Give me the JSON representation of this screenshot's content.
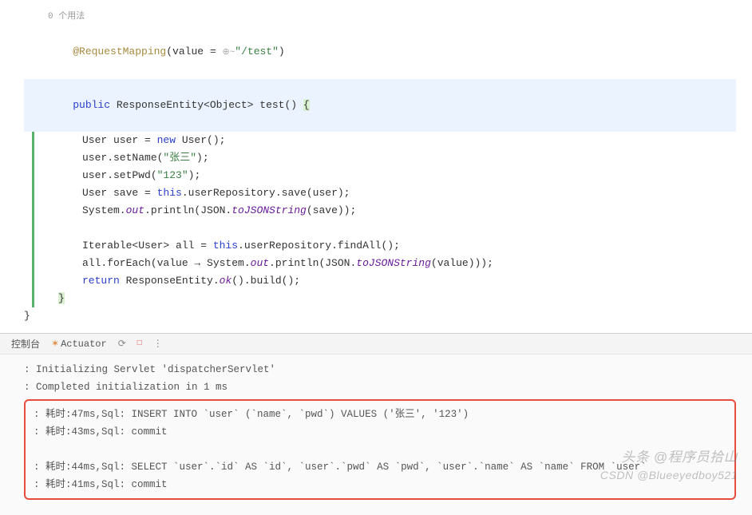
{
  "editor": {
    "usage_hint": "0 个用法",
    "annotation": "@RequestMapping",
    "ann_args_prefix": "(value = ",
    "ann_globe": "⊕~",
    "ann_url": "\"/test\"",
    "ann_args_suffix": ")",
    "line_public": "public",
    "sig_rest": " ResponseEntity<Object> test() ",
    "brace_open": "{",
    "l1a": "User user = ",
    "l1_new": "new",
    "l1b": " User();",
    "l2a": "user.setName(",
    "l2s": "\"张三\"",
    "l2b": ");",
    "l3a": "user.setPwd(",
    "l3s": "\"123\"",
    "l3b": ");",
    "l4a": "User save = ",
    "l4_this": "this",
    "l4b": ".userRepository.save(user);",
    "l5a": "System.",
    "l5_out": "out",
    "l5b": ".println(JSON.",
    "l5_m": "toJSONString",
    "l5c": "(save));",
    "l6a": "Iterable<User> all = ",
    "l6_this": "this",
    "l6b": ".userRepository.findAll();",
    "l7a": "all.forEach(value → System.",
    "l7_out": "out",
    "l7b": ".println(JSON.",
    "l7_m": "toJSONString",
    "l7c": "(value)));",
    "l8_ret": "return",
    "l8a": " ResponseEntity.",
    "l8_m": "ok",
    "l8b": "().build();",
    "brace_close_inner": "}",
    "brace_close_outer": "}"
  },
  "console": {
    "tab1": "控制台",
    "tab2": "Actuator",
    "log1": ": Initializing Servlet 'dispatcherServlet'",
    "log2": ": Completed initialization in 1 ms",
    "sql1": ": 耗时:47ms,Sql: INSERT INTO `user` (`name`, `pwd`) VALUES ('张三', '123')",
    "sql2": ": 耗时:43ms,Sql: commit",
    "sql3": ": 耗时:44ms,Sql: SELECT `user`.`id` AS `id`, `user`.`pwd` AS `pwd`, `user`.`name` AS `name` FROM `user`",
    "sql4": ": 耗时:41ms,Sql: commit"
  },
  "watermark": {
    "line1": "头条 @程序员拾山",
    "line2": "CSDN @Blueeyedboy521"
  }
}
